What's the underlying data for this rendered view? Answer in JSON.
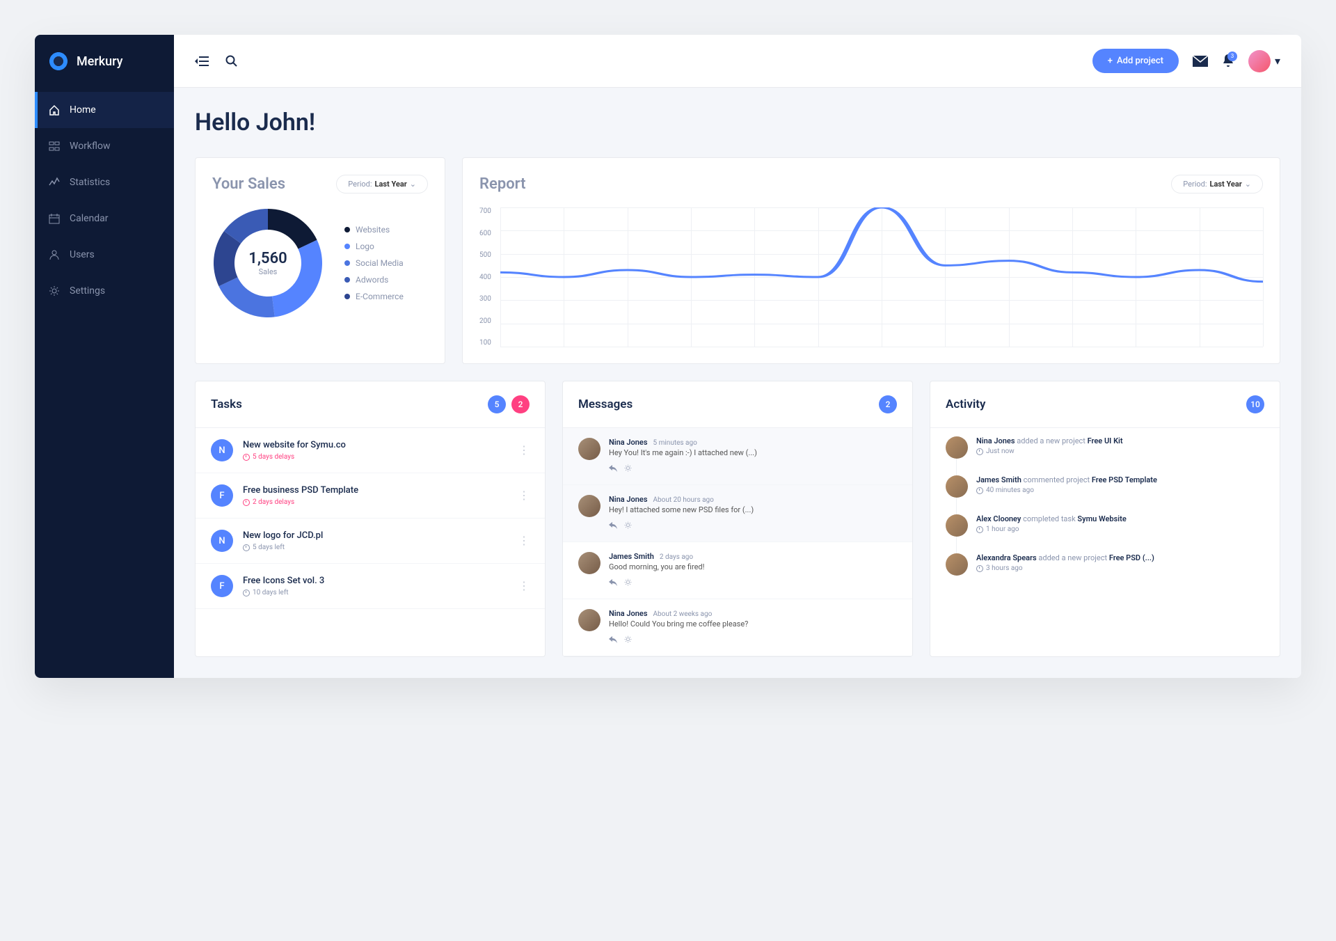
{
  "brand": "Merkury",
  "nav": [
    {
      "label": "Home",
      "icon": "home"
    },
    {
      "label": "Workflow",
      "icon": "workflow"
    },
    {
      "label": "Statistics",
      "icon": "stats"
    },
    {
      "label": "Calendar",
      "icon": "calendar"
    },
    {
      "label": "Users",
      "icon": "user"
    },
    {
      "label": "Settings",
      "icon": "gear"
    }
  ],
  "header": {
    "add_label": "Add project",
    "notif_count": "3"
  },
  "greeting": "Hello John!",
  "sales": {
    "title": "Your Sales",
    "period_prefix": "Period:",
    "period_value": "Last Year",
    "total": "1,560",
    "total_label": "Sales",
    "legend": [
      {
        "label": "Websites",
        "color": "#0e1a35"
      },
      {
        "label": "Logo",
        "color": "#5584ff"
      },
      {
        "label": "Social Media",
        "color": "#4b74e0"
      },
      {
        "label": "Adwords",
        "color": "#3a5bb5"
      },
      {
        "label": "E-Commerce",
        "color": "#2d4590"
      }
    ]
  },
  "report": {
    "title": "Report",
    "period_prefix": "Period:",
    "period_value": "Last Year",
    "ylabels": [
      "700",
      "600",
      "500",
      "400",
      "300",
      "200",
      "100"
    ]
  },
  "chart_data": [
    {
      "type": "pie",
      "title": "Your Sales",
      "total": 1560,
      "series": [
        {
          "name": "Websites",
          "value": 18,
          "color": "#0e1a35"
        },
        {
          "name": "Logo",
          "value": 30,
          "color": "#5584ff"
        },
        {
          "name": "Social Media",
          "value": 20,
          "color": "#4b74e0"
        },
        {
          "name": "Adwords",
          "value": 17,
          "color": "#2d4590"
        },
        {
          "name": "E-Commerce",
          "value": 15,
          "color": "#3a5bb5"
        }
      ]
    },
    {
      "type": "line",
      "title": "Report",
      "ylabel": "",
      "ylim": [
        100,
        700
      ],
      "x": [
        0,
        1,
        2,
        3,
        4,
        5,
        6,
        7,
        8,
        9,
        10,
        11,
        12
      ],
      "series": [
        {
          "name": "Report",
          "values": [
            420,
            400,
            430,
            400,
            410,
            400,
            700,
            450,
            470,
            420,
            400,
            430,
            380
          ],
          "color": "#5584ff"
        }
      ]
    }
  ],
  "tasks": {
    "title": "Tasks",
    "badges": [
      "5",
      "2"
    ],
    "items": [
      {
        "initial": "N",
        "title": "New website for Symu.co",
        "meta": "5 days delays",
        "delay": true
      },
      {
        "initial": "F",
        "title": "Free business PSD Template",
        "meta": "2 days delays",
        "delay": true
      },
      {
        "initial": "N",
        "title": "New logo for JCD.pl",
        "meta": "5 days left",
        "delay": false
      },
      {
        "initial": "F",
        "title": "Free Icons Set vol. 3",
        "meta": "10 days left",
        "delay": false
      }
    ]
  },
  "messages": {
    "title": "Messages",
    "badge": "2",
    "items": [
      {
        "name": "Nina Jones",
        "time": "5 minutes ago",
        "text": "Hey You! It's me again :-) I attached new (...)",
        "hl": true
      },
      {
        "name": "Nina Jones",
        "time": "About 20 hours ago",
        "text": "Hey! I attached some new PSD files for (...)",
        "hl": true
      },
      {
        "name": "James Smith",
        "time": "2 days ago",
        "text": "Good morning, you are fired!",
        "hl": false
      },
      {
        "name": "Nina Jones",
        "time": "About 2 weeks ago",
        "text": "Hello! Could You bring me coffee please?",
        "hl": false
      }
    ]
  },
  "activity": {
    "title": "Activity",
    "badge": "10",
    "items": [
      {
        "name": "Nina Jones",
        "action": " added a new project ",
        "target": "Free UI Kit",
        "time": "Just now"
      },
      {
        "name": "James Smith",
        "action": " commented project ",
        "target": "Free PSD Template",
        "time": "40 minutes ago"
      },
      {
        "name": "Alex Clooney",
        "action": " completed task ",
        "target": "Symu Website",
        "time": "1 hour ago"
      },
      {
        "name": "Alexandra Spears",
        "action": " added a new project ",
        "target": "Free PSD (...)",
        "time": "3 hours ago"
      }
    ]
  }
}
